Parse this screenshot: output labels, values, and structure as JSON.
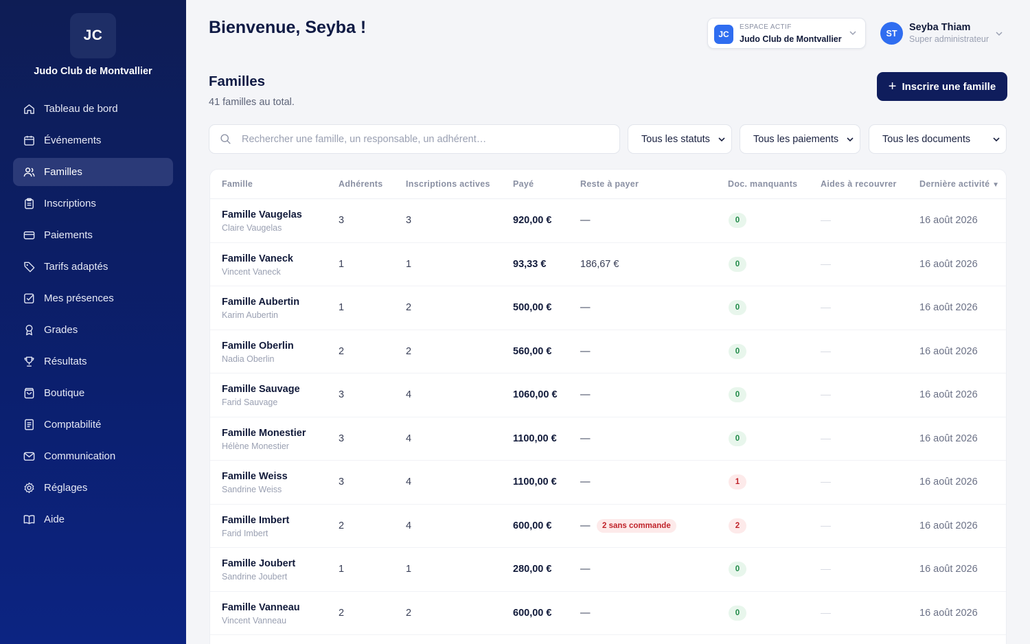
{
  "club": {
    "initials": "JC",
    "name": "Judo Club de Montvallier"
  },
  "nav": [
    {
      "label": "Tableau de bord",
      "icon": "home-icon"
    },
    {
      "label": "Événements",
      "icon": "calendar-icon"
    },
    {
      "label": "Familles",
      "icon": "users-icon",
      "active": true
    },
    {
      "label": "Inscriptions",
      "icon": "clipboard-icon"
    },
    {
      "label": "Paiements",
      "icon": "credit-card-icon"
    },
    {
      "label": "Tarifs adaptés",
      "icon": "tag-icon"
    },
    {
      "label": "Mes présences",
      "icon": "check-square-icon"
    },
    {
      "label": "Grades",
      "icon": "award-icon"
    },
    {
      "label": "Résultats",
      "icon": "trophy-icon"
    },
    {
      "label": "Boutique",
      "icon": "shopping-bag-icon"
    },
    {
      "label": "Comptabilité",
      "icon": "ledger-icon"
    },
    {
      "label": "Communication",
      "icon": "mail-icon"
    },
    {
      "label": "Réglages",
      "icon": "gear-icon"
    },
    {
      "label": "Aide",
      "icon": "book-icon"
    }
  ],
  "header": {
    "welcome": "Bienvenue, Seyba !",
    "space_label": "ESPACE ACTIF",
    "space_initials": "JC",
    "space_name": "Judo Club de Montvallier",
    "user_initials": "ST",
    "user_name": "Seyba Thiam",
    "user_role": "Super administrateur"
  },
  "page": {
    "title": "Familles",
    "subtitle": "41 familles au total.",
    "primary_button": "Inscrire une famille",
    "primary_button_icon": "plus-icon"
  },
  "filters": {
    "search_placeholder": "Rechercher une famille, un responsable, un adhérent…",
    "status": "Tous les statuts",
    "payments": "Tous les paiements",
    "documents": "Tous les documents"
  },
  "table": {
    "columns": [
      "Famille",
      "Adhérents",
      "Inscriptions actives",
      "Payé",
      "Reste à payer",
      "Doc. manquants",
      "Aides à recouvrer",
      "Dernière activité"
    ],
    "sort_indicator": "▼",
    "rows": [
      {
        "name": "Famille Vaugelas",
        "resp": "Claire Vaugelas",
        "members": "3",
        "active": "3",
        "paid": "920,00 €",
        "remaining": "—",
        "docs": "0",
        "aides": "—",
        "activity": "16 août 2026"
      },
      {
        "name": "Famille Vaneck",
        "resp": "Vincent Vaneck",
        "members": "1",
        "active": "1",
        "paid": "93,33 €",
        "remaining": "186,67 €",
        "docs": "0",
        "aides": "—",
        "activity": "16 août 2026"
      },
      {
        "name": "Famille Aubertin",
        "resp": "Karim Aubertin",
        "members": "1",
        "active": "2",
        "paid": "500,00 €",
        "remaining": "—",
        "docs": "0",
        "aides": "—",
        "activity": "16 août 2026"
      },
      {
        "name": "Famille Oberlin",
        "resp": "Nadia Oberlin",
        "members": "2",
        "active": "2",
        "paid": "560,00 €",
        "remaining": "—",
        "docs": "0",
        "aides": "—",
        "activity": "16 août 2026"
      },
      {
        "name": "Famille Sauvage",
        "resp": "Farid Sauvage",
        "members": "3",
        "active": "4",
        "paid": "1060,00 €",
        "remaining": "—",
        "docs": "0",
        "aides": "—",
        "activity": "16 août 2026"
      },
      {
        "name": "Famille Monestier",
        "resp": "Hélène Monestier",
        "members": "3",
        "active": "4",
        "paid": "1100,00 €",
        "remaining": "—",
        "docs": "0",
        "aides": "—",
        "activity": "16 août 2026"
      },
      {
        "name": "Famille Weiss",
        "resp": "Sandrine Weiss",
        "members": "3",
        "active": "4",
        "paid": "1100,00 €",
        "remaining": "—",
        "docs": "1",
        "aides": "—",
        "activity": "16 août 2026"
      },
      {
        "name": "Famille Imbert",
        "resp": "Farid Imbert",
        "members": "2",
        "active": "4",
        "paid": "600,00 €",
        "remaining": "—",
        "remaining_badge": "2 sans commande",
        "docs": "2",
        "aides": "—",
        "activity": "16 août 2026"
      },
      {
        "name": "Famille Joubert",
        "resp": "Sandrine Joubert",
        "members": "1",
        "active": "1",
        "paid": "280,00 €",
        "remaining": "—",
        "docs": "0",
        "aides": "—",
        "activity": "16 août 2026"
      },
      {
        "name": "Famille Vanneau",
        "resp": "Vincent Vanneau",
        "members": "2",
        "active": "2",
        "paid": "600,00 €",
        "remaining": "—",
        "docs": "0",
        "aides": "—",
        "activity": "16 août 2026"
      }
    ]
  },
  "colors": {
    "sidebar": "#0e1d55",
    "accent": "#0f1d5c",
    "badge_blue": "#2f6df0",
    "ok": "#1f8a47",
    "danger": "#c0242b"
  }
}
